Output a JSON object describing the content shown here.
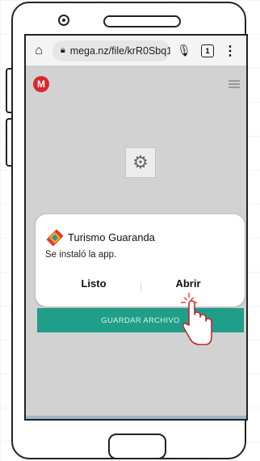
{
  "browser": {
    "url": "mega.nz/file/krR0Sbq1",
    "tab_count": "1",
    "icons": [
      "home-icon",
      "lock-icon",
      "mic-icon",
      "tabs-icon",
      "more-icon"
    ]
  },
  "mega": {
    "logo_letter": "M",
    "save_button_label": "GUARDAR ARCHIVO"
  },
  "dialog": {
    "app_name": "Turismo Guaranda",
    "message": "Se instaló la app.",
    "dismiss_label": "Listo",
    "open_label": "Abrir"
  },
  "colors": {
    "mega_red": "#d9272e",
    "save_teal": "#1f9e8a",
    "screen_overlay": "#d2d2d2"
  }
}
